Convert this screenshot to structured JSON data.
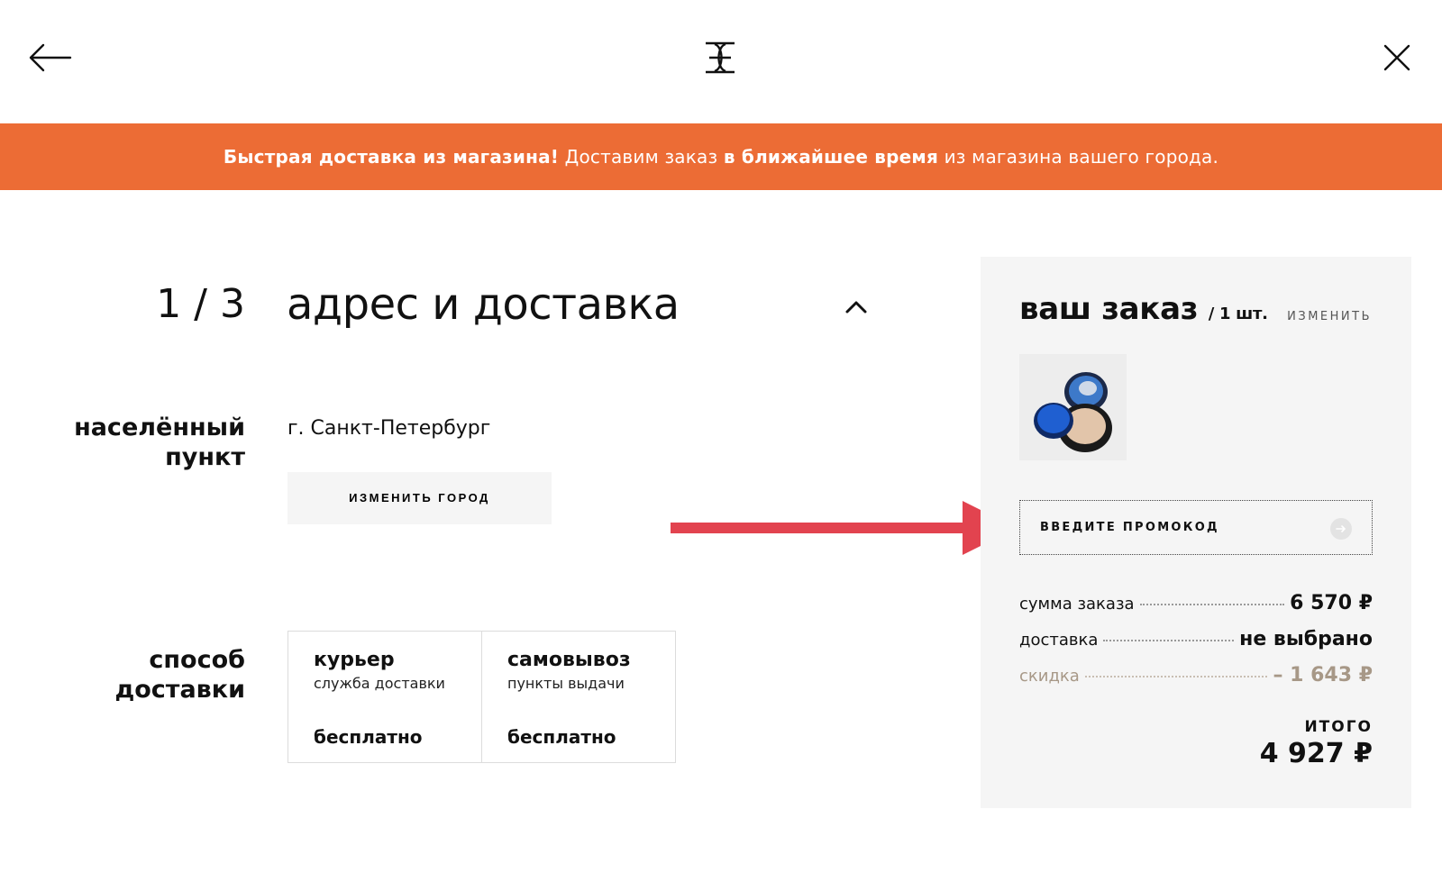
{
  "banner": {
    "part1_bold": "Быстрая доставка из магазина!",
    "part2": "Доставим заказ",
    "part3_bold": "в ближайшее время",
    "part4": "из магазина вашего города."
  },
  "step": {
    "number": "1 / 3",
    "title": "адрес и доставка"
  },
  "city": {
    "label_line1": "населённый",
    "label_line2": "пункт",
    "value": "г. Санкт-Петербург",
    "change_button": "ИЗМЕНИТЬ ГОРОД"
  },
  "delivery": {
    "label_line1": "способ",
    "label_line2": "доставки",
    "options": [
      {
        "name": "курьер",
        "sub": "служба доставки",
        "price": "бесплатно"
      },
      {
        "name": "самовывоз",
        "sub": "пункты выдачи",
        "price": "бесплатно"
      }
    ]
  },
  "order": {
    "title": "ваш заказ",
    "count": "/ 1 шт.",
    "edit": "ИЗМЕНИТЬ",
    "promo_placeholder": "ВВЕДИТЕ ПРОМОКОД",
    "rows": [
      {
        "key": "сумма заказа",
        "value": "6 570 ₽"
      },
      {
        "key": "доставка",
        "value": "не выбрано"
      },
      {
        "key": "скидка",
        "value": "– 1 643 ₽"
      }
    ],
    "total_label": "ИТОГО",
    "total_value": "4 927 ₽"
  },
  "colors": {
    "banner": "#ec6c35",
    "arrow": "#e2434f",
    "discount": "#a79887",
    "panel": "#f5f5f5"
  },
  "icons": {
    "back": "arrow-left-icon",
    "logo": "brand-logo-icon",
    "close": "close-icon",
    "collapse": "chevron-up-icon",
    "promo_submit": "arrow-right-circle-icon"
  }
}
